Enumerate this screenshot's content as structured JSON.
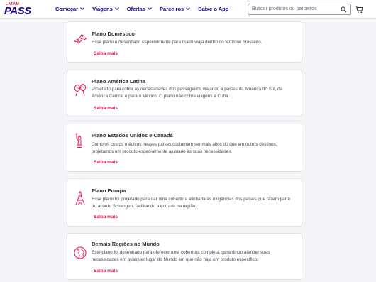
{
  "header": {
    "logo": {
      "top": "LATAM",
      "main": "PASS"
    },
    "nav": [
      {
        "label": "Começar"
      },
      {
        "label": "Viagens"
      },
      {
        "label": "Ofertas"
      },
      {
        "label": "Parceiros"
      },
      {
        "label": "Baixe o App"
      }
    ],
    "search": {
      "placeholder": "Buscar produtos ou parceiros",
      "icon": "search-icon"
    },
    "cart_icon": "cart-icon"
  },
  "colors": {
    "brand": "#1b0088",
    "accent": "#e8114b",
    "background": "#f4f4f6"
  },
  "plans": [
    {
      "title": "Plano Doméstico",
      "description": "Esse plano é desenhado especialmente para quem viaja dentro do território brasileiro.",
      "link": "Saiba mais",
      "icon": "airplane-icon"
    },
    {
      "title": "Plano América Latina",
      "description": "Projetado para cobrir as necessidades dos passageiros viajando a países da América do Sul, da América Central e para o México. O plano não cobre viagens a Cuba.",
      "link": "Saiba mais",
      "icon": "maracas-icon"
    },
    {
      "title": "Plano Estados Unidos e Canadá",
      "description": "Como os custos médicos nesses países costumam ser mais altos do que em outros destinos, projetamos um produto especialmente ajustado às suas necessidades.",
      "link": "Saiba mais",
      "icon": "statue-of-liberty-icon"
    },
    {
      "title": "Plano Europa",
      "description": "Esse plano foi projetado para dar uma cobertura alinhada às exigências dos países que fazem parte do acordo Schengen, facilitando a entrada na região.",
      "link": "Saiba mais",
      "icon": "eiffel-tower-icon"
    },
    {
      "title": "Demais Regiões no Mundo",
      "description": "Este plano foi desenhado para oferecer uma cobertura completa, garantindo atender suas necessidades em qualquer lugar do Mundo em que não haja um produto específico.",
      "link": "Saiba mais",
      "icon": "globe-icon"
    }
  ]
}
